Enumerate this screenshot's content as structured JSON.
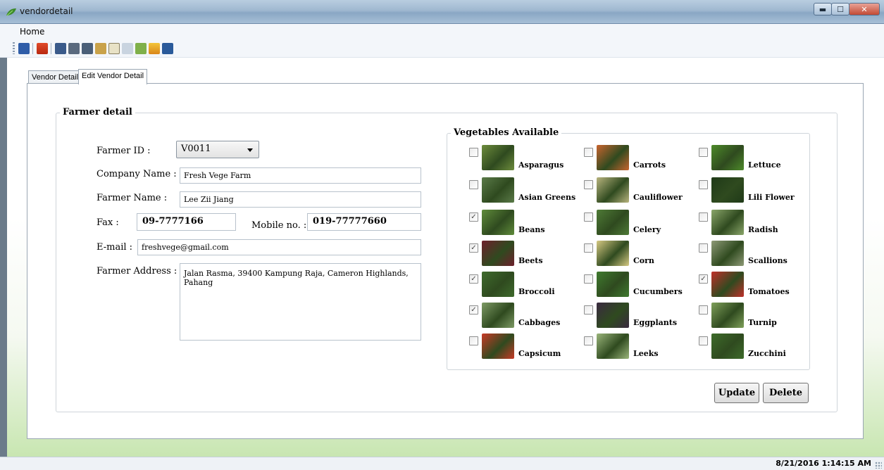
{
  "window": {
    "title": "vendordetail",
    "min_glyph": "▬",
    "max_glyph": "☐",
    "close_glyph": "✕"
  },
  "menu": {
    "home": "Home"
  },
  "toolbar": {
    "icons": [
      "save-icon",
      "home-icon",
      "grid-icon",
      "open-book-icon",
      "person-icon",
      "store-icon",
      "clipboard-icon",
      "list-icon",
      "leaf-icon",
      "warning-icon",
      "book-icon"
    ]
  },
  "tabs": [
    {
      "label": "Vendor Detail",
      "active": false
    },
    {
      "label": "Edit Vendor Detail",
      "active": true
    }
  ],
  "farmer": {
    "group_title": "Farmer detail",
    "id_label": "Farmer ID :",
    "id_value": "V0011",
    "company_label": "Company Name :",
    "company_value": "Fresh Vege Farm",
    "name_label": "Farmer Name :",
    "name_value": "Lee Zii Jiang",
    "fax_label": "Fax :",
    "fax_value": "09-7777166",
    "mobile_label": "Mobile no. :",
    "mobile_value": "019-77777660",
    "email_label": "E-mail :",
    "email_value": "freshvege@gmail.com",
    "address_label": "Farmer Address :",
    "address_value": "Jalan Rasma, 39400 Kampung Raja, Cameron Highlands, Pahang"
  },
  "vegetables": {
    "group_title": "Vegetables Available",
    "items": [
      {
        "name": "Asparagus",
        "checked": false,
        "color": "#6d8c3c"
      },
      {
        "name": "Carrots",
        "checked": false,
        "color": "#c8642e"
      },
      {
        "name": "Lettuce",
        "checked": false,
        "color": "#4d8a2a"
      },
      {
        "name": "Asian Greens",
        "checked": false,
        "color": "#5a7a48"
      },
      {
        "name": "Cauliflower",
        "checked": false,
        "color": "#b8b47e"
      },
      {
        "name": "Lili Flower",
        "checked": false,
        "color": "#1f3a18"
      },
      {
        "name": "Beans",
        "checked": true,
        "color": "#5f8b3a"
      },
      {
        "name": "Celery",
        "checked": false,
        "color": "#4e7a36"
      },
      {
        "name": "Radish",
        "checked": false,
        "color": "#8aa66a"
      },
      {
        "name": "Beets",
        "checked": true,
        "color": "#6e1f2c"
      },
      {
        "name": "Corn",
        "checked": false,
        "color": "#d6c982"
      },
      {
        "name": "Scallions",
        "checked": false,
        "color": "#8e9a76"
      },
      {
        "name": "Broccoli",
        "checked": true,
        "color": "#3e6a2c"
      },
      {
        "name": "Cucumbers",
        "checked": false,
        "color": "#3f7a2e"
      },
      {
        "name": "Tomatoes",
        "checked": true,
        "color": "#c0302a"
      },
      {
        "name": "Cabbages",
        "checked": true,
        "color": "#7d9a64"
      },
      {
        "name": "Eggplants",
        "checked": false,
        "color": "#3a2a40"
      },
      {
        "name": "Turnip",
        "checked": false,
        "color": "#7fa05a"
      },
      {
        "name": "Capsicum",
        "checked": false,
        "color": "#c83a26"
      },
      {
        "name": "Leeks",
        "checked": false,
        "color": "#9ab57a"
      },
      {
        "name": "Zucchini",
        "checked": false,
        "color": "#3d6b2a"
      }
    ]
  },
  "buttons": {
    "update": "Update",
    "delete": "Delete"
  },
  "status": {
    "datetime": "8/21/2016 1:14:15 AM"
  }
}
